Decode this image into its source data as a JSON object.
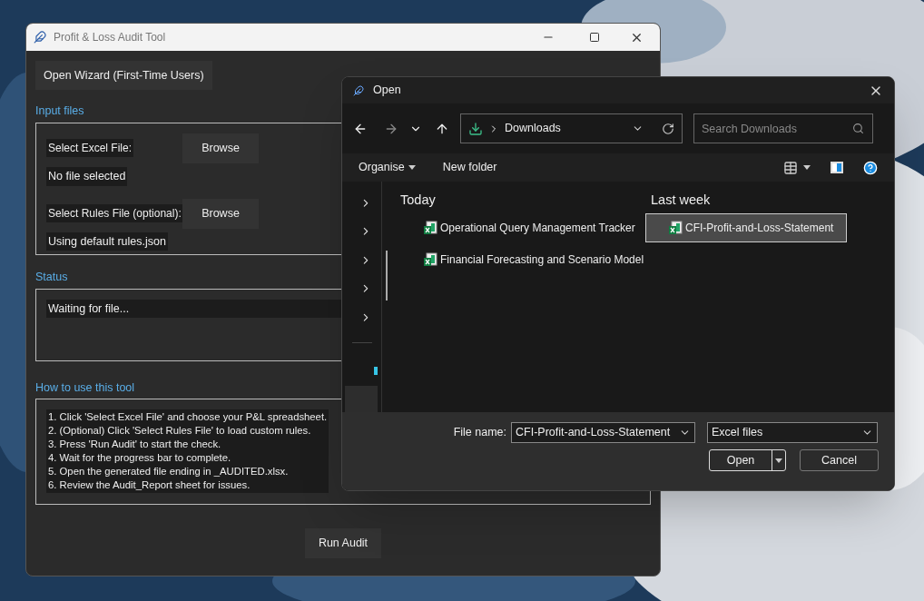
{
  "main_window": {
    "title": "Profit & Loss Audit Tool",
    "wizard_button": "Open Wizard (First-Time Users)",
    "input_files": {
      "label": "Input files",
      "rows": [
        {
          "label": "Select Excel File:",
          "button": "Browse",
          "status": "No file selected"
        },
        {
          "label": "Select Rules File (optional):",
          "button": "Browse",
          "status": "Using default rules.json"
        }
      ]
    },
    "status": {
      "label": "Status",
      "text": "Waiting for file..."
    },
    "how_to": {
      "label": "How to use this tool",
      "lines": [
        "1. Click 'Select Excel File' and choose your P&L spreadsheet.",
        "2. (Optional) Click 'Select Rules File' to load custom rules.",
        "3. Press 'Run Audit' to start the check.",
        "4. Wait for the progress bar to complete.",
        "5. Open the generated file ending in _AUDITED.xlsx.",
        "6. Review the Audit_Report sheet for issues."
      ]
    },
    "run_button": "Run Audit"
  },
  "dialog": {
    "title": "Open",
    "location": "Downloads",
    "search": {
      "placeholder": "Search Downloads"
    },
    "toolbar": [
      "Organise",
      "New folder"
    ],
    "groups": [
      {
        "heading": "Today",
        "files": [
          {
            "name": "Operational Query Management Tracker",
            "selected": false
          },
          {
            "name": "Financial Forecasting and Scenario Model",
            "selected": false
          }
        ]
      },
      {
        "heading": "Last week",
        "files": [
          {
            "name": "CFI-Profit-and-Loss-Statement",
            "selected": true
          }
        ]
      }
    ],
    "file_name_label": "File name:",
    "file_name": "CFI-Profit-and-Loss-Statement",
    "file_type": "Excel files",
    "open_button": "Open",
    "cancel_button": "Cancel"
  }
}
